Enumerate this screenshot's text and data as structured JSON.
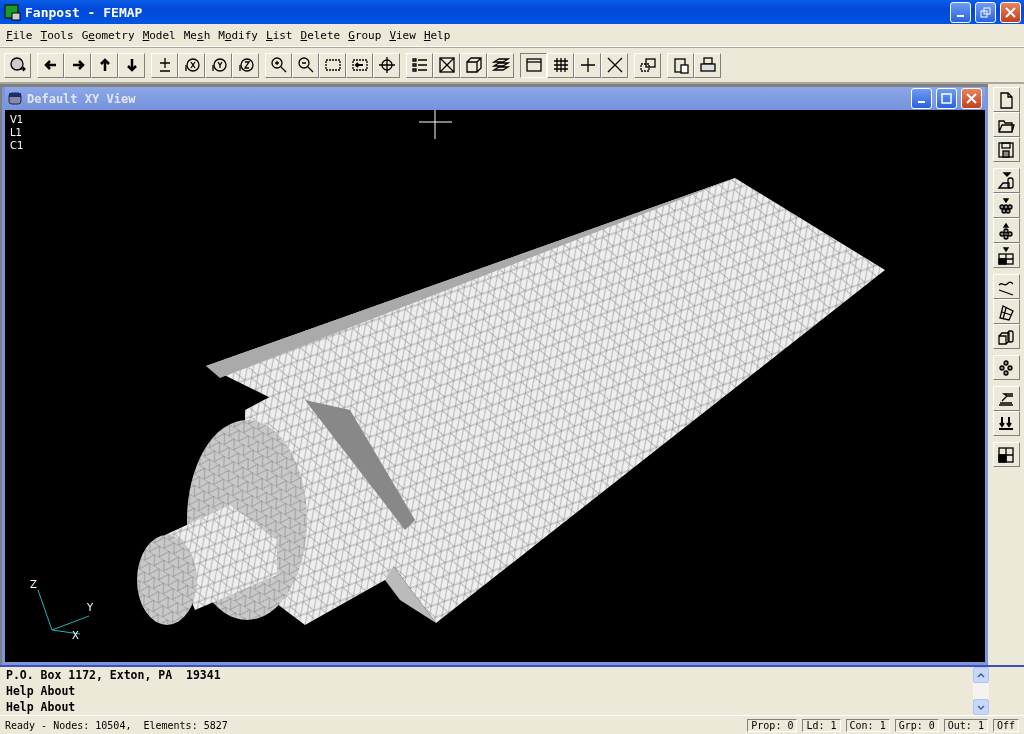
{
  "window": {
    "title": "Fanpost - FEMAP"
  },
  "menu": [
    {
      "access_key": "F",
      "rest": "ile"
    },
    {
      "access_key": "T",
      "rest": "ools"
    },
    {
      "lead": "G",
      "access_key": "e",
      "rest": "ometry"
    },
    {
      "access_key": "M",
      "rest": "odel"
    },
    {
      "lead": "Me",
      "access_key": "s",
      "rest": "h"
    },
    {
      "lead": "M",
      "access_key": "o",
      "rest": "dify"
    },
    {
      "access_key": "L",
      "rest": "ist"
    },
    {
      "access_key": "D",
      "rest": "elete"
    },
    {
      "access_key": "G",
      "rest": "roup"
    },
    {
      "access_key": "V",
      "rest": "iew"
    },
    {
      "access_key": "H",
      "rest": "elp"
    }
  ],
  "view_window": {
    "title": "Default XY View",
    "info_lines": [
      "V1",
      "L1",
      "C1"
    ],
    "axes": {
      "z": "Z",
      "y": "Y",
      "x": "X"
    }
  },
  "messages": [
    "P.O. Box 1172, Exton, PA  19341",
    "Help About",
    "Help About"
  ],
  "status_bar": {
    "text": "Ready - Nodes: 10504,  Elements: 5827",
    "panes": [
      "Prop: 0",
      "Ld: 1",
      "Con: 1",
      "Grp: 0",
      "Out: 1",
      "Off"
    ]
  }
}
